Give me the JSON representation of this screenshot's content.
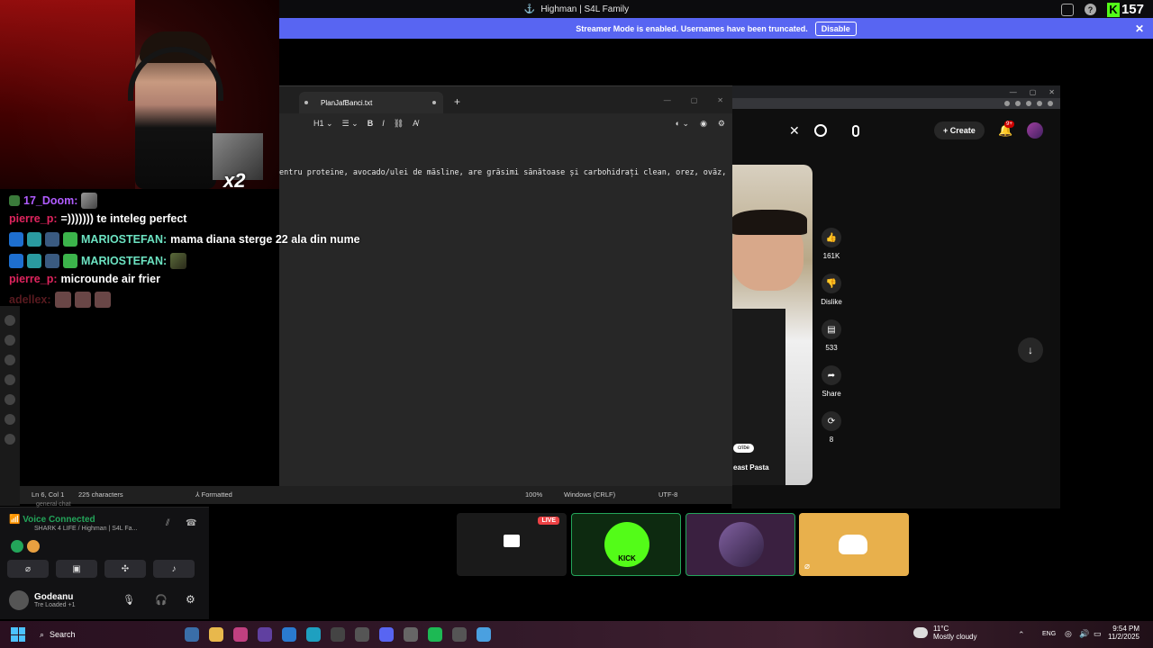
{
  "topbar": {
    "title": "Highman | S4L Family",
    "viewer_count": "157",
    "kick_letter": "K"
  },
  "streamer_banner": {
    "text": "Streamer Mode is enabled. Usernames have been truncated.",
    "disable_label": "Disable",
    "close_glyph": "✕"
  },
  "webcam": {
    "gift_multiplier": "x2"
  },
  "notepad": {
    "tab_title": "PlanJafBanci.txt",
    "toolbar": {
      "heading": "H1",
      "bold": "B",
      "italic": "I"
    },
    "body_line": "entru proteine, avocado/ulei de măsline, are grăsimi sănătoase și carbohidrați clean, orez, ovăz,",
    "status": {
      "position": "Ln 6, Col 1",
      "characters": "225 characters",
      "format": "Formatted",
      "zoom": "100%",
      "line_ending": "Windows (CRLF)",
      "encoding": "UTF-8"
    }
  },
  "youtube": {
    "create_label": "Create",
    "notif_badge": "9+",
    "likes": "161K",
    "dislike_label": "Dislike",
    "comments": "533",
    "share_label": "Share",
    "remix_count": "8",
    "subscribe_label": "cribe",
    "short_title": "east Pasta"
  },
  "chat": {
    "messages": [
      {
        "user": "17_Doom:",
        "text": "",
        "user_color": "#b05cff"
      },
      {
        "user": "pierre_p:",
        "text": "=))))))) te inteleg perfect",
        "user_color": "#e0245e"
      },
      {
        "user": "MARIOSTEFAN:",
        "text": "mama diana sterge 22 ala din nume",
        "user_color": "#6ce3c2"
      },
      {
        "user": "MARIOSTEFAN:",
        "text": "",
        "user_color": "#6ce3c2"
      },
      {
        "user": "pierre_p:",
        "text": "microunde air frier",
        "user_color": "#e0245e"
      },
      {
        "user": "adellex:",
        "text": "",
        "user_color": "#a0303a"
      }
    ]
  },
  "voice": {
    "channel_hint": "general chat",
    "status": "Voice Connected",
    "server": "SHARK 4 LIFE / Highman | S4L Fa...",
    "username": "Godeanu",
    "user_status": "Tre Loaded +1"
  },
  "tiles": {
    "live_label": "LIVE",
    "kick_label": "KICK"
  },
  "taskbar": {
    "search_label": "Search",
    "weather_temp": "11°C",
    "weather_desc": "Mostly cloudy",
    "language": "ENG",
    "time": "9:54 PM",
    "date": "11/2/2025"
  },
  "colors": {
    "discord_blurple": "#5865f2",
    "kick_green": "#53fc18",
    "voice_green": "#23a55a",
    "live_red": "#ed4245"
  }
}
